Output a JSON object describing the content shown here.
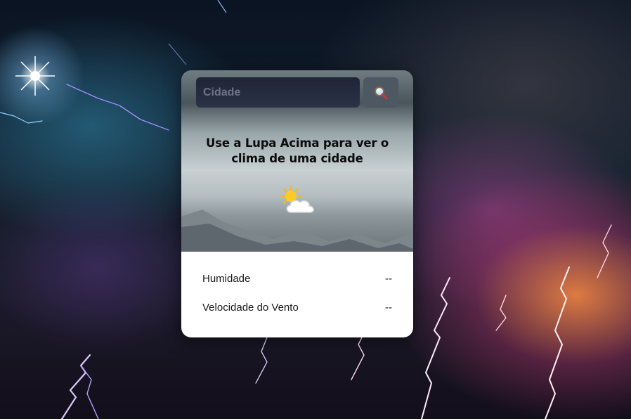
{
  "search": {
    "placeholder": "Cidade",
    "button_icon": "magnifier-icon"
  },
  "main": {
    "prompt": "Use a Lupa Acima para ver o clima de uma cidade",
    "weather_icon": "sun-behind-cloud-icon"
  },
  "details": {
    "humidity_label": "Humidade",
    "humidity_value": "--",
    "wind_label": "Velocidade do Vento",
    "wind_value": "--"
  }
}
